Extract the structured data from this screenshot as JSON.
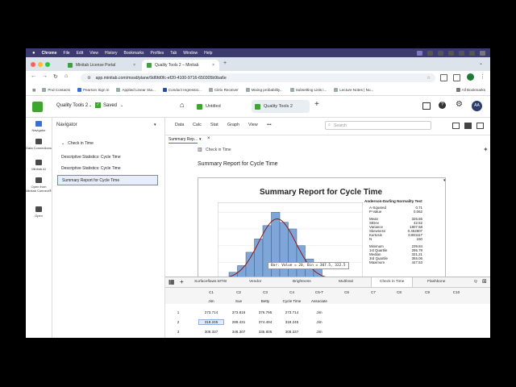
{
  "menubar": {
    "app": "Chrome",
    "items": [
      "File",
      "Edit",
      "View",
      "History",
      "Bookmarks",
      "Profiles",
      "Tab",
      "Window",
      "Help"
    ],
    "right": "Ask Gemini"
  },
  "browser": {
    "tabs": [
      {
        "label": "Minitab License Portal"
      },
      {
        "label": "Quality Tools 2 – Minitab"
      }
    ],
    "new_tab": "+",
    "url": "app.minitab.com/mssd/plane/9d6fd0fc-ef20-4100-9716-650305b9ba6e",
    "bookmarks": [
      "Pnd Contacts",
      "Pearson Sign in",
      "Applied Linear Sta...",
      "Conduct regressio...",
      "Citrix Receiver",
      "Mixing probability...",
      "Subsetting Lists i...",
      "Lecture Notes | Nu..."
    ],
    "all_bookmarks": "All Bookmarks"
  },
  "app": {
    "project": "Quality Tools 2",
    "saved": "Saved",
    "tabs": [
      "Untitled",
      "Quality Tools 2"
    ],
    "user_initials": "AA",
    "rail": [
      "Navigator",
      "Data Connections",
      "Minitab AI",
      "Open from Minitab Connect®",
      "Open"
    ],
    "navigator": {
      "title": "Navigator",
      "group": "Check in Time",
      "items": [
        "Descriptive Statistics: Cycle Time",
        "Descriptive Statistics: Cycle Time",
        "Summary Report for Cycle Time"
      ]
    },
    "menu": [
      "Data",
      "Calc",
      "Stat",
      "Graph",
      "View",
      "•••"
    ],
    "search_placeholder": "Search",
    "output_tab": "Summary Rep...",
    "breadcrumb": "Check in Time",
    "output_heading": "Summary Report for Cycle Time"
  },
  "report": {
    "title": "Summary Report for Cycle Time",
    "ad_title": "Anderson-Darling Normality Test",
    "stats": [
      {
        "k": "A-Squared",
        "v": "0.71"
      },
      {
        "k": "P-Value",
        "v": "0.062"
      },
      {
        "k": "Mean",
        "v": "326.66"
      },
      {
        "k": "StDev",
        "v": "42.52"
      },
      {
        "k": "Variance",
        "v": "1807.58"
      },
      {
        "k": "Skewness",
        "v": "0.452807"
      },
      {
        "k": "Kurtosis",
        "v": "0.881117"
      },
      {
        "k": "N",
        "v": "150"
      },
      {
        "k": "Minimum",
        "v": "239.84"
      },
      {
        "k": "1st Quartile",
        "v": "295.79"
      },
      {
        "k": "Median",
        "v": "321.21"
      },
      {
        "k": "3rd Quartile",
        "v": "355.06"
      },
      {
        "k": "Maximum",
        "v": "447.53"
      }
    ],
    "tooltip": "Bar: Value = 20, Bin = 307.5, 322.5"
  },
  "chart_data": {
    "type": "bar",
    "categories": [
      "240",
      "255",
      "270",
      "285",
      "300",
      "315",
      "330",
      "345",
      "360",
      "375",
      "390"
    ],
    "values": [
      2,
      4,
      8,
      12,
      16,
      20,
      17,
      15,
      10,
      6,
      3
    ],
    "ylim": [
      0,
      22
    ],
    "fit_curve": "normal"
  },
  "worksheet": {
    "tabs": [
      "Surfaceflaws.MTW",
      "Vendor",
      "Brightness",
      "MultiVari",
      "Check in Time",
      "Flashbone",
      "Q"
    ],
    "col_ids": [
      "C1",
      "C2",
      "C3",
      "C4",
      "C5-T",
      "C6",
      "C7",
      "C8",
      "C9",
      "C10"
    ],
    "col_names": [
      "Jim",
      "Sue",
      "Betty",
      "Cycle Time",
      "Associate",
      "",
      "",
      "",
      "",
      ""
    ],
    "rows": [
      {
        "n": "1",
        "c": [
          "273.714",
          "373.816",
          "376.795",
          "273.714",
          "Jim"
        ]
      },
      {
        "n": "2",
        "c": [
          "318.245",
          "289.431",
          "374.494",
          "318.245",
          "Jim"
        ]
      },
      {
        "n": "3",
        "c": [
          "308.337",
          "348.307",
          "335.805",
          "308.337",
          "Jim"
        ]
      }
    ]
  }
}
